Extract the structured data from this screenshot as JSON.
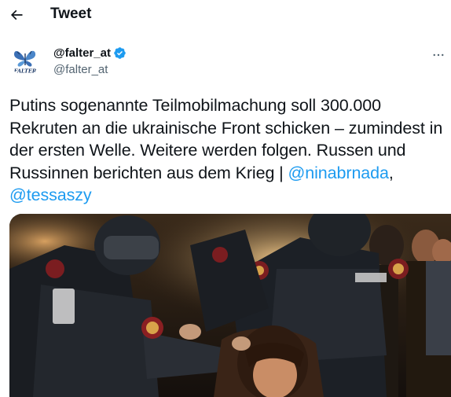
{
  "header": {
    "title": "Tweet",
    "back_icon": "arrow-left-icon"
  },
  "author": {
    "display_name": "@falter_at",
    "handle": "@falter_at",
    "verified_icon": "verified-badge-icon",
    "avatar_logo_text": "FALTER"
  },
  "tweet": {
    "text_part1": "Putins sogenannte Teilmobilmachung soll 300.000 Rekruten an die ukrainische Front schicken – zumindest in der ersten Welle. Weitere werden folgen. Russen und Russinnen berichten aus dem Krieg | ",
    "mention1": "@ninabrnada",
    "separator": ", ",
    "mention2": "@tessaszy",
    "more_icon": "more-horizontal-icon"
  },
  "colors": {
    "accent": "#1d9bf0",
    "text": "#0f1419",
    "secondary": "#536471"
  }
}
